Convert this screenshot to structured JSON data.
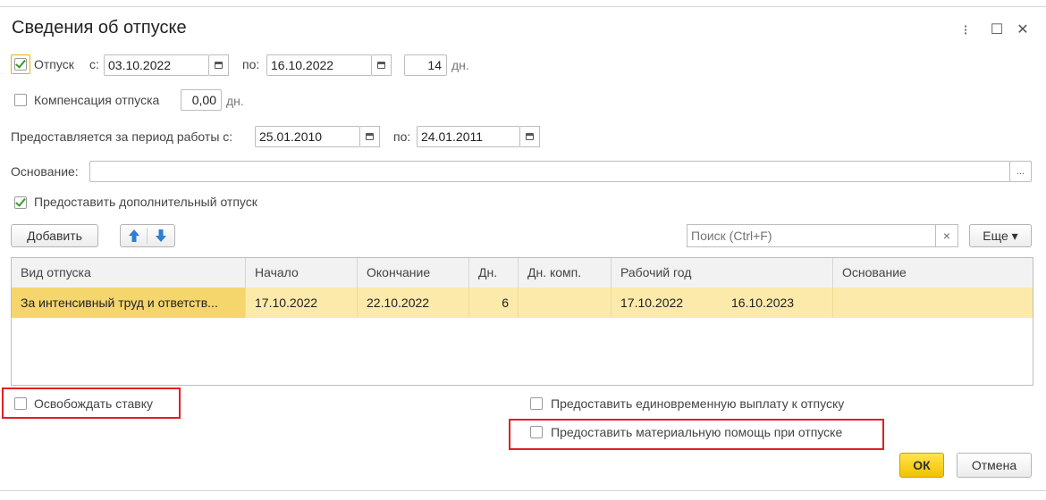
{
  "window": {
    "title": "Сведения об отпуске",
    "menu_icon": "⁝",
    "maximize_icon": "☐",
    "close_icon": "✕"
  },
  "vacation": {
    "checked": true,
    "label": "Отпуск",
    "from_label": "с:",
    "from_value": "03.10.2022",
    "to_label": "по:",
    "to_value": "16.10.2022",
    "days_value": "14",
    "days_suffix": "дн."
  },
  "compensation": {
    "checked": false,
    "label": "Компенсация отпуска",
    "value": "0,00",
    "suffix": "дн."
  },
  "period": {
    "label": "Предоставляется за период работы с:",
    "from_value": "25.01.2010",
    "to_label": "по:",
    "to_value": "24.01.2011"
  },
  "basis": {
    "label": "Основание:",
    "value": "",
    "ellipsis": "..."
  },
  "additional": {
    "checked": true,
    "label": "Предоставить дополнительный отпуск"
  },
  "toolbar": {
    "add_label": "Добавить",
    "up_icon": "arrow-up-icon",
    "down_icon": "arrow-down-icon",
    "search_placeholder": "Поиск (Ctrl+F)",
    "clear_glyph": "×",
    "more_label": "Еще ▾"
  },
  "table": {
    "columns": [
      "Вид отпуска",
      "Начало",
      "Окончание",
      "Дн.",
      "Дн. комп.",
      "Рабочий год",
      "Основание"
    ],
    "rows": [
      {
        "kind": "За интенсивный труд и ответств...",
        "start": "17.10.2022",
        "end": "22.10.2022",
        "days": "6",
        "comp_days": "",
        "work_year_from": "17.10.2022",
        "work_year_to": "16.10.2023",
        "basis": ""
      }
    ]
  },
  "options": {
    "release_rate": {
      "checked": false,
      "label": "Освобождать ставку"
    },
    "lump_sum": {
      "checked": false,
      "label": "Предоставить единовременную выплату к отпуску"
    },
    "material_aid": {
      "checked": false,
      "label": "Предоставить материальную помощь при отпуске"
    }
  },
  "footer": {
    "ok_label": "ОК",
    "cancel_label": "Отмена"
  },
  "colors": {
    "highlight_red": "#e31e24",
    "selected_row": "#fbeaa9",
    "selected_cell": "#f5d66c",
    "ok_button": "#f2c200",
    "checkmark": "#3a9a2c",
    "arrow_blue": "#2e7fd1"
  }
}
